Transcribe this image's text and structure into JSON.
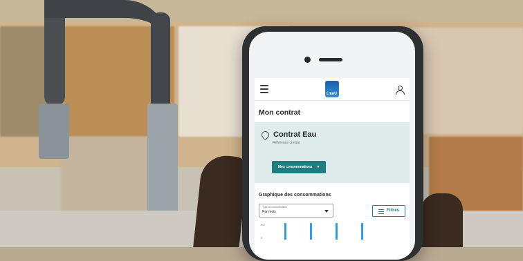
{
  "screen": {
    "logo_text": "L'EAU",
    "title": "Mon contrat",
    "contract": {
      "title": "Contrat Eau",
      "subtitle": "Référence contrat"
    },
    "button": {
      "label": "Mes consommations"
    },
    "graph": {
      "title": "Graphique des consommations",
      "select": {
        "label": "Type de consommation",
        "value": "Par mois"
      },
      "filter_label": "Filtres",
      "y_tick": "m3",
      "x_tick": "0"
    }
  },
  "chart_data": {
    "type": "bar",
    "ylabel": "m3",
    "series": [
      {
        "values": [
          1,
          1,
          1,
          1
        ]
      }
    ],
    "colors": [
      "#2a9df4"
    ]
  }
}
